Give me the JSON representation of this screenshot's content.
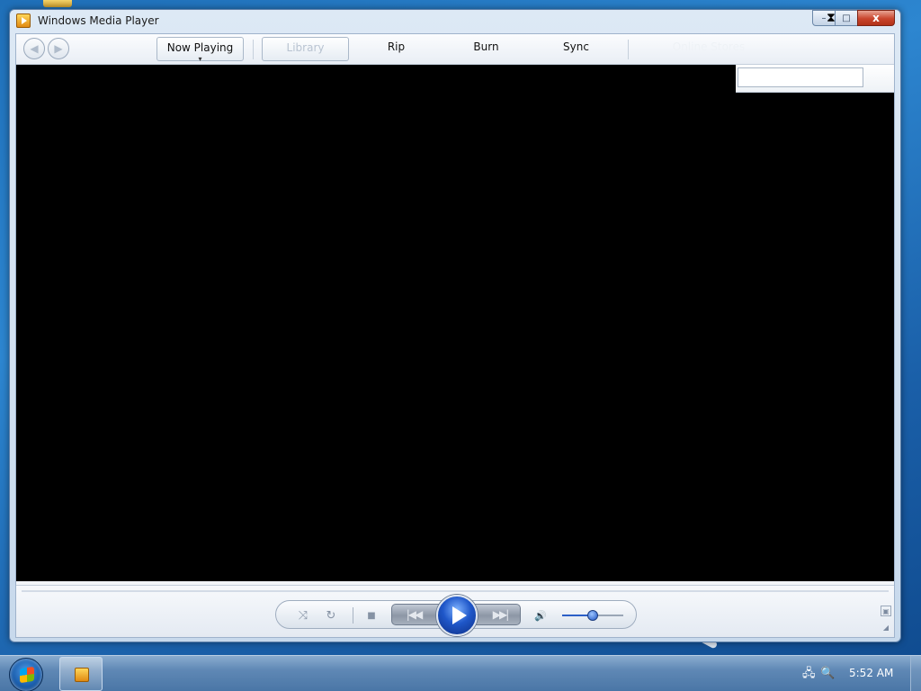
{
  "window": {
    "title": "Windows Media Player",
    "caption": {
      "minimize": "–",
      "maximize": "□",
      "close": "x"
    }
  },
  "nav": {
    "back_glyph": "◀",
    "forward_glyph": "▶",
    "tabs": {
      "now_playing": "Now Playing",
      "library": "Library",
      "rip": "Rip",
      "burn": "Burn",
      "sync": "Sync",
      "online_stores": "Online Stores"
    }
  },
  "search": {
    "placeholder": ""
  },
  "controls": {
    "shuffle_glyph": "⤨",
    "repeat_glyph": "↻",
    "stop_glyph": "■",
    "prev_glyph": "|◀◀",
    "next_glyph": "▶▶|",
    "mute_glyph": "🔊",
    "volume_level": 0.5
  },
  "taskbar": {
    "clock": "5:52 AM"
  },
  "icons": {
    "app": "media-player-icon",
    "start": "windows-logo-icon",
    "tray_network": "network-icon",
    "tray_search": "search-icon"
  }
}
